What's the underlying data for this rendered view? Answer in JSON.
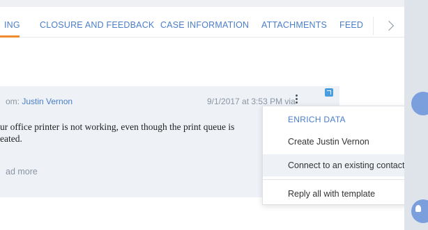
{
  "tabs": {
    "items": [
      {
        "label": "ING"
      },
      {
        "label": "CLOSURE AND FEEDBACK"
      },
      {
        "label": "CASE INFORMATION"
      },
      {
        "label": "ATTACHMENTS"
      },
      {
        "label": "FEED"
      }
    ],
    "next_icon": "chevron-right-icon"
  },
  "message": {
    "from_prefix": "om: ",
    "from_name": "Justin Vernon",
    "date": "9/1/2017 at 3:53 PM via",
    "body_line1": "ur office printer is not working, even though the print queue is",
    "body_line2": "eated.",
    "read_more": "ad more"
  },
  "menu": {
    "header": "ENRICH DATA",
    "items": [
      {
        "label": "Create Justin Vernon"
      },
      {
        "label": "Connect to an existing contact"
      },
      {
        "label": "Reply all with template"
      }
    ]
  },
  "colors": {
    "accent": "#4a7dc9",
    "tab_underline": "#f08a2e",
    "card_bg": "#eef2f7",
    "side_panel": "#dfe3ea"
  }
}
